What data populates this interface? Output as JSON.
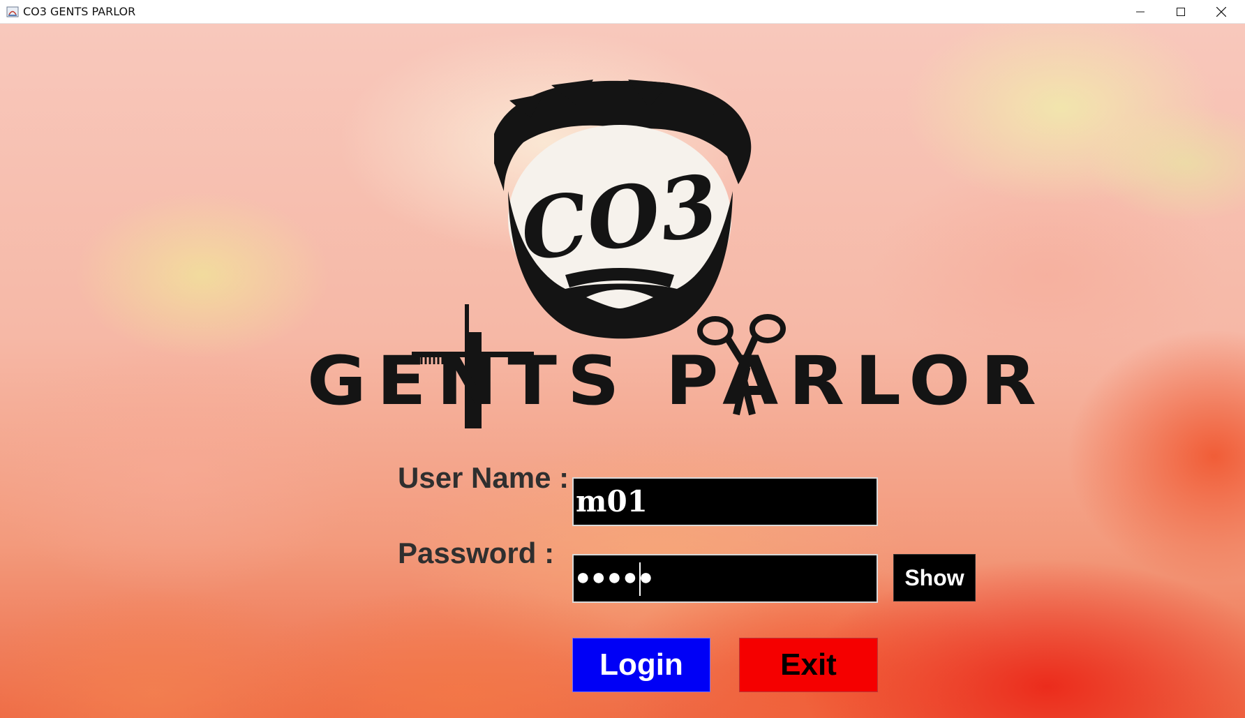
{
  "window": {
    "title": "CO3 GENTS PARLOR",
    "icons": [
      "app-icon",
      "minimize-icon",
      "maximize-icon",
      "close-icon"
    ]
  },
  "logo": {
    "badge_text": "CO3",
    "brand_text": "GENTS PARLOR"
  },
  "login_form": {
    "username_label": "User Name :",
    "username_value": "m01",
    "password_label": "Password :",
    "password_masked": "●●●●●",
    "show_label": "Show",
    "login_label": "Login",
    "exit_label": "Exit"
  },
  "colors": {
    "login_button": "#0000f6",
    "exit_button": "#f50000",
    "input_background": "#000000",
    "show_button": "#000000"
  }
}
